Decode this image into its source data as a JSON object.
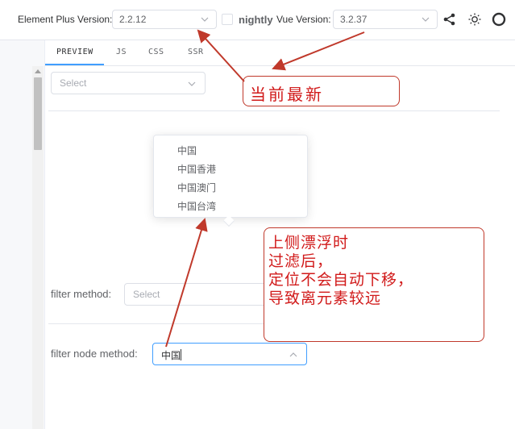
{
  "header": {
    "ep_label": "Element Plus Version:",
    "ep_version": "2.2.12",
    "nightly_label": "nightly",
    "vue_label": "Vue Version:",
    "vue_version": "3.2.37",
    "icons": [
      "share-icon",
      "sun-icon",
      "github-icon"
    ]
  },
  "tabs": [
    {
      "label": "PREVIEW",
      "active": true
    },
    {
      "label": "JS",
      "active": false
    },
    {
      "label": "CSS",
      "active": false
    },
    {
      "label": "SSR",
      "active": false
    }
  ],
  "preview": {
    "top_select_placeholder": "Select",
    "dropdown_items": [
      "中国",
      "中国香港",
      "中国澳门",
      "中国台湾"
    ],
    "filter_method_label": "filter method:",
    "filter_method_placeholder": "Select",
    "filter_node_label": "filter node method:",
    "filter_node_value": "中国"
  },
  "annotations": {
    "note1": "当前最新",
    "note2_lines": [
      "上侧漂浮时",
      "过滤后，",
      "定位不会自动下移，",
      "导致离元素较远"
    ]
  },
  "colors": {
    "accent": "#409eff",
    "annotation_red": "#d11a1a",
    "border": "#dcdfe6"
  }
}
